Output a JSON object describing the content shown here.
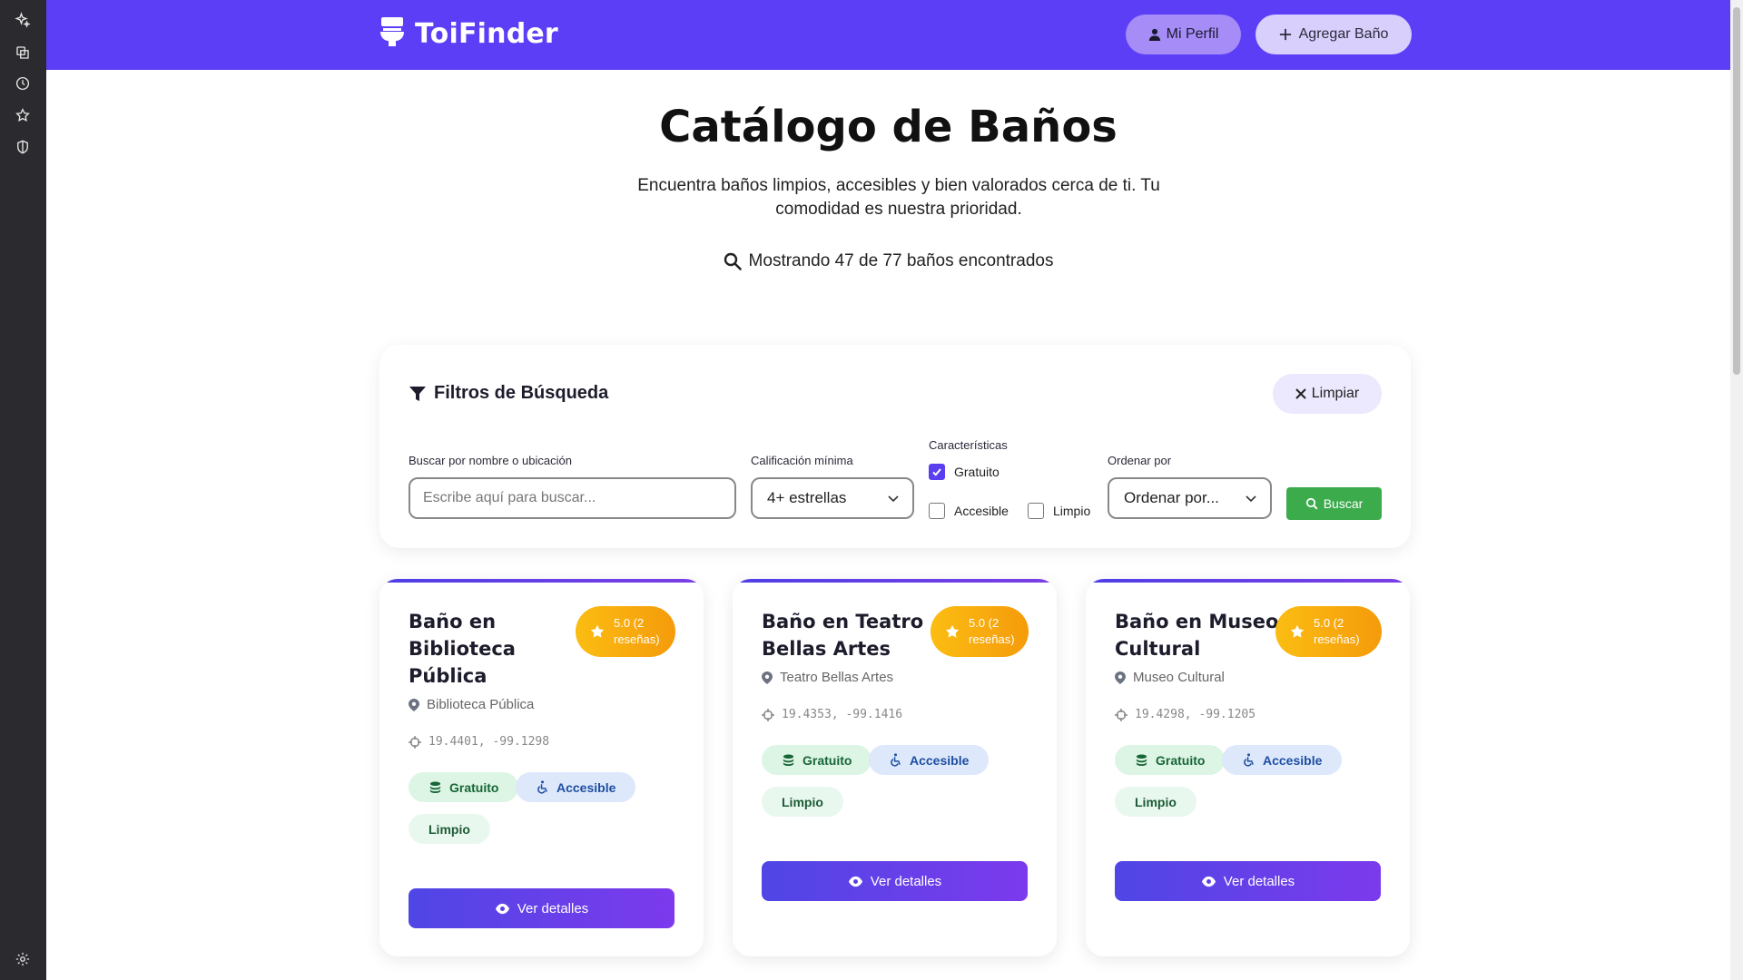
{
  "brand": {
    "name": "ToiFinder"
  },
  "header": {
    "profile_label": "Mi Perfil",
    "add_label": "Agregar Baño"
  },
  "hero": {
    "title": "Catálogo de Baños",
    "subtitle": "Encuentra baños limpios, accesibles y bien valorados cerca de ti. Tu comodidad es nuestra prioridad.",
    "count_text": "Mostrando 47 de 77 baños encontrados"
  },
  "filters": {
    "title": "Filtros de Búsqueda",
    "clear_label": "Limpiar",
    "search_label": "Buscar por nombre o ubicación",
    "search_placeholder": "Escribe aquí para buscar...",
    "search_value": "",
    "rating_label": "Calificación mínima",
    "rating_value": "4+ estrellas",
    "features_label": "Características",
    "features": [
      {
        "label": "Gratuito",
        "checked": true
      },
      {
        "label": "Accesible",
        "checked": false
      },
      {
        "label": "Limpio",
        "checked": false
      }
    ],
    "sort_label": "Ordenar por",
    "sort_value": "Ordenar por...",
    "search_button": "Buscar"
  },
  "cards": [
    {
      "title_lines": [
        "Baño en",
        "Biblioteca",
        "Pública"
      ],
      "rating": "5.0 (2",
      "reviews": "reseñas)",
      "location": "Biblioteca Pública",
      "coords": "19.4401, -99.1298",
      "tags": [
        "Gratuito",
        "Accesible",
        "Limpio"
      ],
      "button": "Ver detalles"
    },
    {
      "title_lines": [
        "Baño en Teatro",
        "Bellas Artes"
      ],
      "rating": "5.0 (2",
      "reviews": "reseñas)",
      "location": "Teatro Bellas Artes",
      "coords": "19.4353, -99.1416",
      "tags": [
        "Gratuito",
        "Accesible",
        "Limpio"
      ],
      "button": "Ver detalles"
    },
    {
      "title_lines": [
        "Baño en Museo",
        "Cultural"
      ],
      "rating": "5.0 (2",
      "reviews": "reseñas)",
      "location": "Museo Cultural",
      "coords": "19.4298, -99.1205",
      "tags": [
        "Gratuito",
        "Accesible",
        "Limpio"
      ],
      "button": "Ver detalles"
    }
  ],
  "colors": {
    "header": "#5b3ef5",
    "accent": "#5a3ff0",
    "search_button": "#3bab4c",
    "rating_badge": "#f7a90f"
  },
  "icons": {
    "sidebar": [
      "sparkle-icon",
      "tab-icon",
      "history-icon",
      "star-icon",
      "shield-icon",
      "settings-icon"
    ],
    "brand": "toilet-icon",
    "profile": "user-icon",
    "add": "plus-icon",
    "count": "search-icon",
    "filters": "filter-icon",
    "clear": "close-icon",
    "rating": "star-icon",
    "location": "map-pin-icon",
    "coords": "crosshair-icon",
    "free_tag": "coins-icon",
    "accessible_tag": "wheelchair-icon",
    "details": "eye-icon"
  }
}
